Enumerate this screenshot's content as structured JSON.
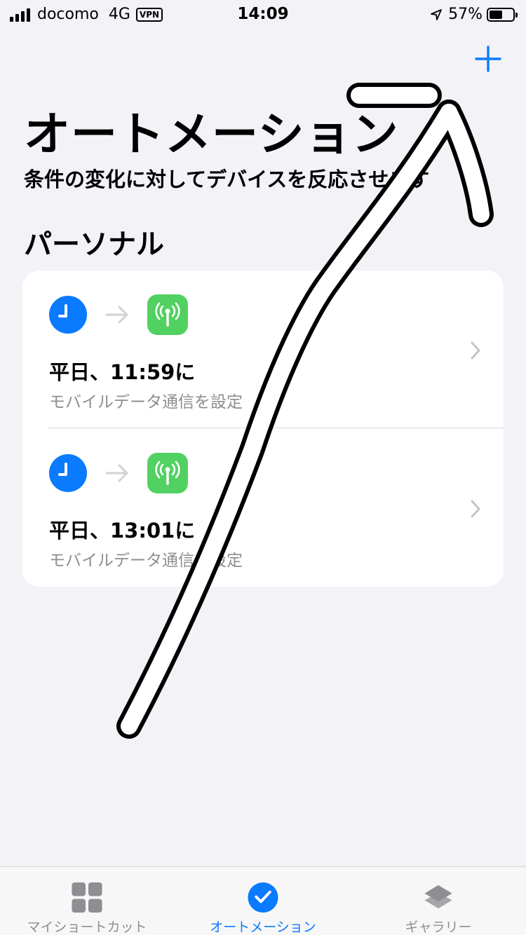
{
  "status_bar": {
    "carrier": "docomo",
    "network": "4G",
    "vpn": "VPN",
    "time": "14:09",
    "battery_percent": "57%",
    "battery_level": 0.57
  },
  "header": {
    "title": "オートメーション",
    "subtitle": "条件の変化に対してデバイスを反応させます",
    "add_icon": "plus-icon"
  },
  "section": {
    "title": "パーソナル"
  },
  "automations": [
    {
      "trigger_icon": "clock-icon",
      "action_icon": "cellular-icon",
      "title": "平日、11:59に",
      "subtitle": "モバイルデータ通信を設定"
    },
    {
      "trigger_icon": "clock-icon",
      "action_icon": "cellular-icon",
      "title": "平日、13:01に",
      "subtitle": "モバイルデータ通信を設定"
    }
  ],
  "tab_bar": {
    "tabs": [
      {
        "label": "マイショートカット",
        "icon": "grid-icon",
        "active": false
      },
      {
        "label": "オートメーション",
        "icon": "checkmark-circle-icon",
        "active": true
      },
      {
        "label": "ギャラリー",
        "icon": "layers-icon",
        "active": false
      }
    ]
  },
  "colors": {
    "accent": "#0a7aff",
    "cellular_green": "#52d163",
    "background": "#f2f2f7",
    "secondary_text": "#8e8e93"
  }
}
